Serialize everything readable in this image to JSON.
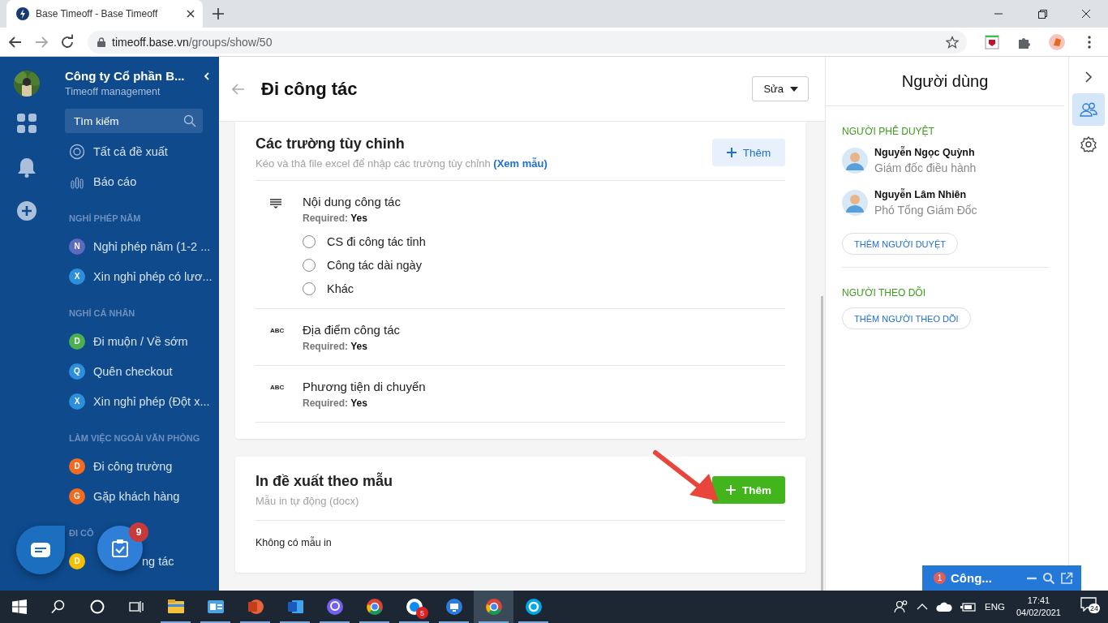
{
  "browser": {
    "tab_title": "Base Timeoff - Base Timeoff",
    "url_host": "timeoff.base.vn",
    "url_path": "/groups/show/50"
  },
  "sidebar": {
    "company": "Công ty Cổ phần B...",
    "subtitle": "Timeoff management",
    "search": {
      "placeholder": "Tìm kiếm"
    },
    "links": [
      {
        "kind": "target",
        "label": "Tất cả đề xuất"
      },
      {
        "kind": "chart",
        "label": "Báo cáo"
      }
    ],
    "groups": [
      {
        "title": "NGHỈ PHÉP NĂM",
        "items": [
          {
            "letter": "N",
            "label": "Nghỉ phép năm (1-2 ...",
            "color": "#5c6bc0"
          },
          {
            "letter": "X",
            "label": "Xin nghỉ phép có lươ...",
            "color": "#2d8fdc"
          }
        ]
      },
      {
        "title": "NGHỈ CÁ NHÂN",
        "items": [
          {
            "letter": "D",
            "label": "Đi muộn / Về sớm",
            "color": "#4caf50"
          },
          {
            "letter": "Q",
            "label": "Quên checkout",
            "color": "#2d8fdc"
          },
          {
            "letter": "X",
            "label": "Xin nghỉ phép (Đột x...",
            "color": "#2d8fdc"
          }
        ]
      },
      {
        "title": "LÀM VIỆC NGOÀI VĂN PHÒNG",
        "items": [
          {
            "letter": "D",
            "label": "Đi công trường",
            "color": "#f26b21"
          },
          {
            "letter": "G",
            "label": "Gặp khách hàng",
            "color": "#f26b21"
          }
        ]
      },
      {
        "title": "ĐI CÔ",
        "items": [
          {
            "letter": "D",
            "label": "ng tác",
            "color": "#f5c000"
          }
        ]
      }
    ]
  },
  "page": {
    "title": "Đi công tác",
    "edit_button": "Sửa"
  },
  "custom_fields": {
    "title": "Các trường tùy chỉnh",
    "hint": "Kéo và thả file excel để nhập các trường tùy chỉnh",
    "hint_link": "(Xem mẫu)",
    "add_button": "Thêm",
    "fields": [
      {
        "kind": "paragraph",
        "name": "Nội dung công tác",
        "required_label": "Required:",
        "required_value": "Yes",
        "options": [
          {
            "label": "CS đi công tác tỉnh",
            "selected": false
          },
          {
            "label": "Công tác dài ngày",
            "selected": false
          },
          {
            "label": "Khác",
            "selected": false
          }
        ]
      },
      {
        "kind": "text",
        "icon_text": "ABC",
        "name": "Địa điểm công tác",
        "required_label": "Required:",
        "required_value": "Yes"
      },
      {
        "kind": "text",
        "icon_text": "ABC",
        "name": "Phương tiện di chuyển",
        "required_label": "Required:",
        "required_value": "Yes"
      }
    ]
  },
  "print_templates": {
    "title": "In đề xuất theo mẫu",
    "subtitle": "Mẫu in tự động (docx)",
    "add_button": "Thêm",
    "empty_text": "Không có mẫu in"
  },
  "users_panel": {
    "title": "Người dùng",
    "approvers_title": "NGƯỜI PHÊ DUYỆT",
    "approvers": [
      {
        "name": "Nguyễn Ngọc Quỳnh",
        "role": "Giám đốc điều hành"
      },
      {
        "name": "Nguyễn Lâm Nhiên",
        "role": "Phó Tổng Giám Đốc"
      }
    ],
    "add_approver": "THÊM NGƯỜI DUYỆT",
    "followers_title": "NGƯỜI THEO DÕI",
    "add_follower": "THÊM NGƯỜI THEO DÕI"
  },
  "right_rail": {
    "tabs": [
      {
        "kind": "users",
        "selected": true
      },
      {
        "kind": "settings",
        "selected": false
      }
    ]
  },
  "floating": {
    "task_badge": "9"
  },
  "chat_popup": {
    "badge": "1",
    "title": "Công..."
  },
  "taskbar": {
    "apps": [
      {
        "kind": "folder",
        "selected": false
      },
      {
        "kind": "card",
        "selected": false
      },
      {
        "kind": "slides",
        "selected": false
      },
      {
        "kind": "document",
        "selected": false
      },
      {
        "kind": "chat",
        "selected": false
      },
      {
        "kind": "browser",
        "selected": false
      },
      {
        "kind": "messenger",
        "badge": "5",
        "selected": false
      },
      {
        "kind": "screen",
        "selected": false
      },
      {
        "kind": "browser",
        "selected": true
      },
      {
        "kind": "skype",
        "selected": false
      }
    ],
    "language": "ENG",
    "time": "17:41",
    "date": "04/02/2021",
    "notifications": "24"
  }
}
